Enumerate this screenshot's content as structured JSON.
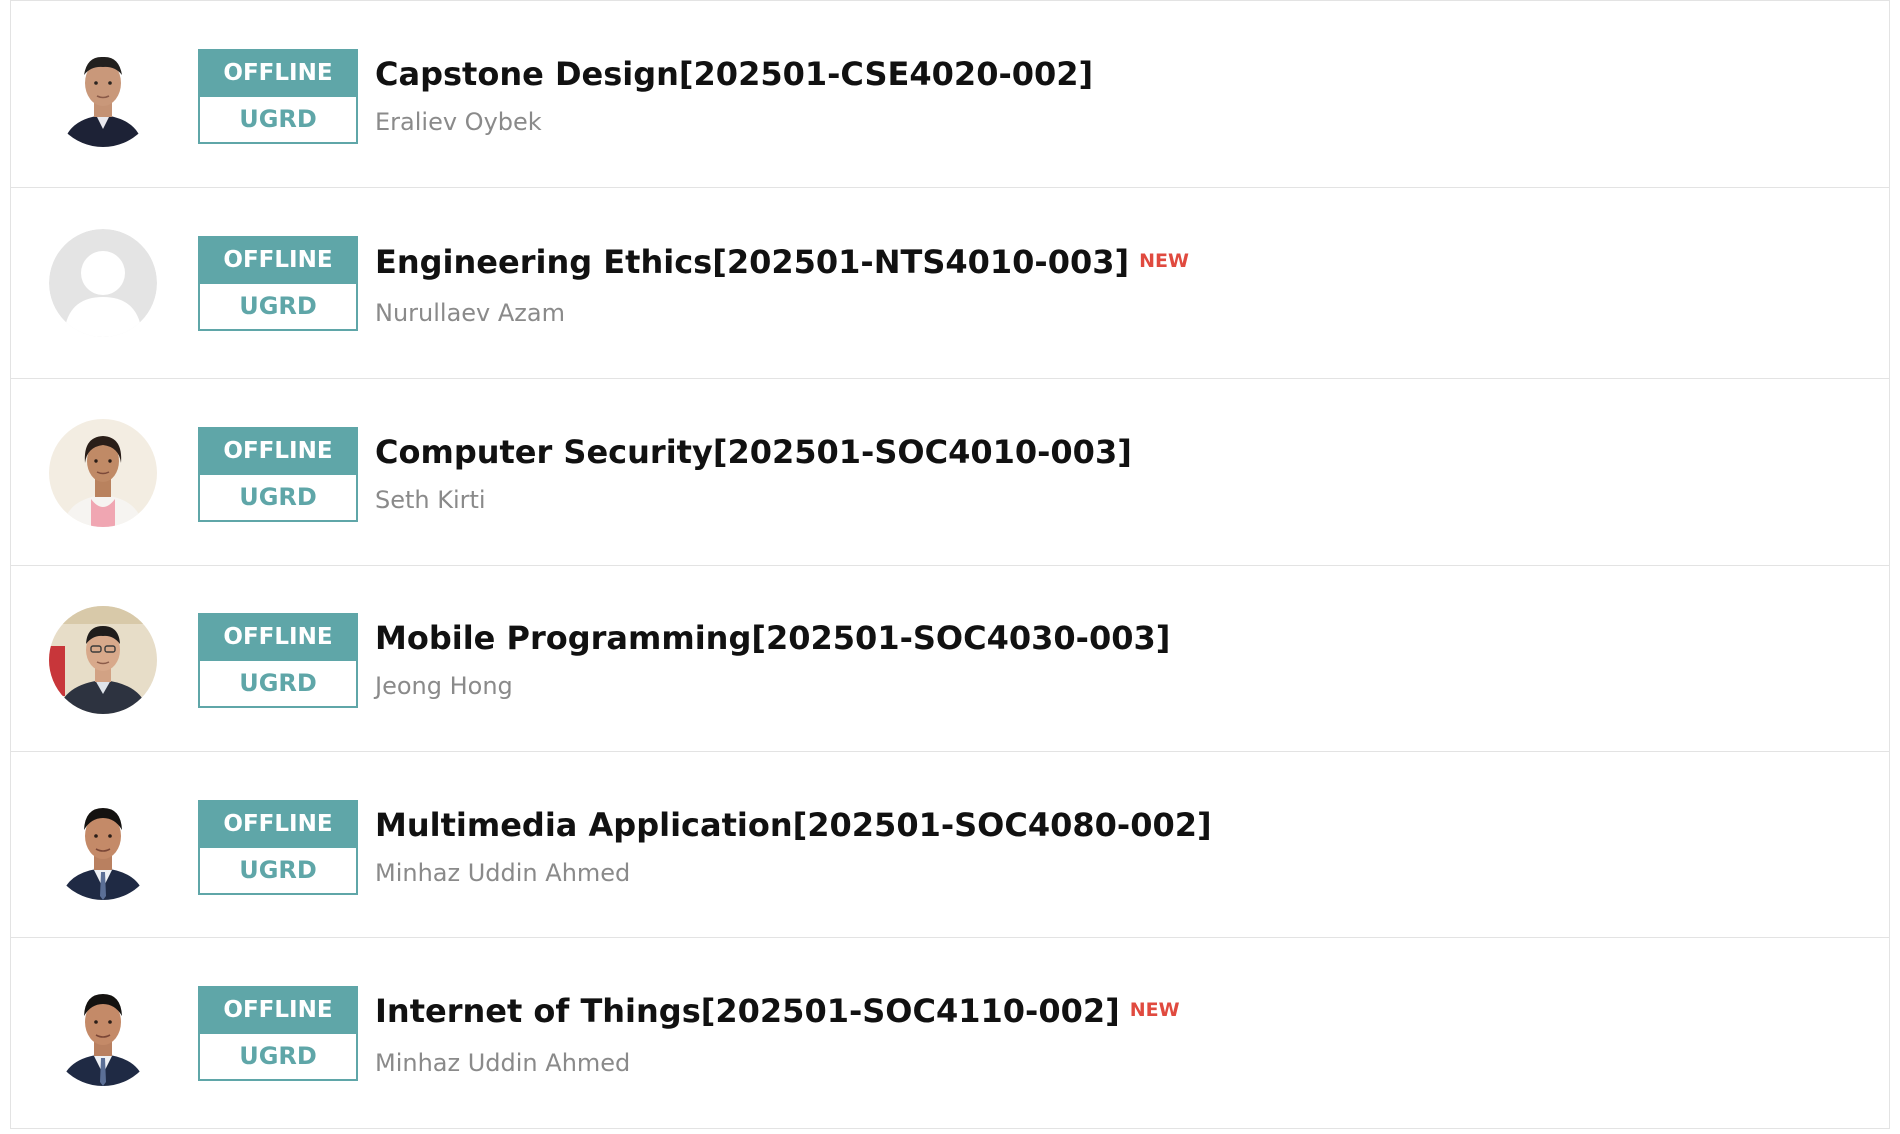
{
  "courses": [
    {
      "status": "OFFLINE",
      "level": "UGRD",
      "title": "Capstone Design[202501-CSE4020-002]",
      "new_label": "",
      "instructor": "Eraliev Oybek",
      "avatar": "instructor-photo"
    },
    {
      "status": "OFFLINE",
      "level": "UGRD",
      "title": "Engineering Ethics[202501-NTS4010-003]",
      "new_label": "NEW",
      "instructor": "Nurullaev Azam",
      "avatar": "default-user-icon"
    },
    {
      "status": "OFFLINE",
      "level": "UGRD",
      "title": "Computer Security[202501-SOC4010-003]",
      "new_label": "",
      "instructor": "Seth Kirti",
      "avatar": "instructor-photo"
    },
    {
      "status": "OFFLINE",
      "level": "UGRD",
      "title": "Mobile Programming[202501-SOC4030-003]",
      "new_label": "",
      "instructor": "Jeong Hong",
      "avatar": "instructor-photo"
    },
    {
      "status": "OFFLINE",
      "level": "UGRD",
      "title": "Multimedia Application[202501-SOC4080-002]",
      "new_label": "",
      "instructor": "Minhaz Uddin Ahmed",
      "avatar": "instructor-photo"
    },
    {
      "status": "OFFLINE",
      "level": "UGRD",
      "title": "Internet of Things[202501-SOC4110-002]",
      "new_label": "NEW",
      "instructor": "Minhaz Uddin Ahmed",
      "avatar": "instructor-photo"
    }
  ],
  "colors": {
    "badge_teal": "#5fa6a8",
    "new_red": "#e04a3f",
    "title": "#111111",
    "instructor": "#8a8a8a",
    "divider": "#e3e3e3"
  }
}
